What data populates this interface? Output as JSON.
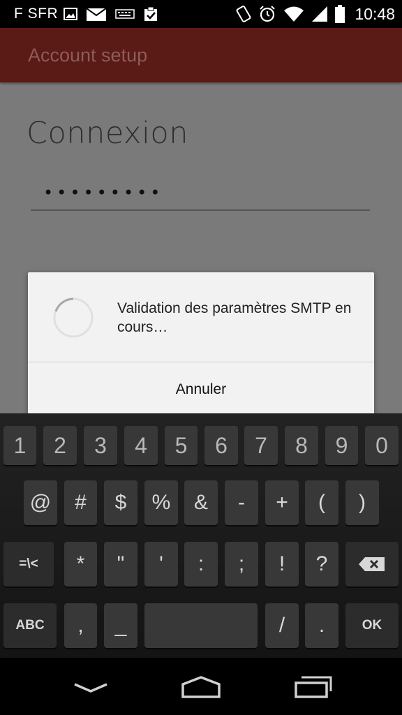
{
  "status_bar": {
    "carrier": "F SFR",
    "time": "10:48",
    "left_icons": [
      "image-icon",
      "mail-icon",
      "keyboard-icon",
      "clipboard-check-icon"
    ],
    "right_icons": [
      "rotate-icon",
      "alarm-icon",
      "wifi-icon",
      "signal-icon",
      "battery-icon"
    ]
  },
  "action_bar": {
    "title": "Account setup"
  },
  "form": {
    "heading": "Connexion",
    "password_value": "•••••••••"
  },
  "dialog": {
    "message": "Validation des paramètres SMTP en cours…",
    "cancel_label": "Annuler"
  },
  "keyboard": {
    "row1": [
      "1",
      "2",
      "3",
      "4",
      "5",
      "6",
      "7",
      "8",
      "9",
      "0"
    ],
    "row2": [
      "@",
      "#",
      "$",
      "%",
      "&",
      "-",
      "+",
      "(",
      ")"
    ],
    "row3": [
      "=\\<",
      "*",
      "\"",
      "'",
      ":",
      ";",
      "!",
      "?",
      "backspace-icon"
    ],
    "row4": [
      "ABC",
      ",",
      "_",
      "space",
      "/",
      ".",
      "OK"
    ]
  },
  "nav_bar": {
    "buttons": [
      "back-icon",
      "home-icon",
      "recents-icon"
    ]
  }
}
